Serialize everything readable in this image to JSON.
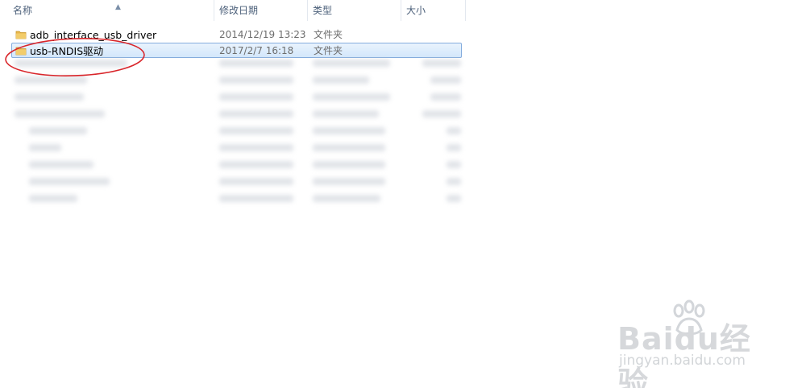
{
  "columns": {
    "name": "名称",
    "date_modified": "修改日期",
    "type": "类型",
    "size": "大小"
  },
  "files": [
    {
      "name": "adb_interface_usb_driver",
      "date": "2014/12/19 13:23",
      "type": "文件夹",
      "selected": false
    },
    {
      "name": "usb-RNDIS驱动",
      "date": "2017/2/7 16:18",
      "type": "文件夹",
      "selected": true
    }
  ],
  "annotation": {
    "color": "#d9262b"
  },
  "watermark": {
    "brand": "Baidu经验",
    "url": "jingyan.baidu.com"
  },
  "colors": {
    "folder": "#e8b64a",
    "selection": "#d3e7fb",
    "header_text": "#4c607a"
  }
}
